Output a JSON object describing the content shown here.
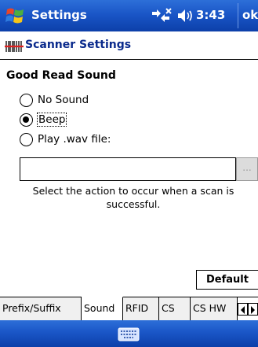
{
  "titlebar": {
    "title": "Settings",
    "time": "3:43",
    "ok_label": "ok"
  },
  "header": {
    "title": "Scanner Settings"
  },
  "section": {
    "title": "Good Read Sound"
  },
  "options": [
    {
      "label": "No Sound",
      "selected": false
    },
    {
      "label": "Beep",
      "selected": true
    },
    {
      "label": "Play .wav file:",
      "selected": false
    }
  ],
  "file": {
    "value": "",
    "browse_label": "..."
  },
  "help_text": "Select the action to occur when a scan is successful.",
  "default_label": "Default",
  "tabs": [
    {
      "label": "Prefix/Suffix",
      "active": false
    },
    {
      "label": "Sound",
      "active": true
    },
    {
      "label": "RFID",
      "active": false
    },
    {
      "label": "CS",
      "active": false
    },
    {
      "label": "CS HW",
      "active": false
    }
  ],
  "colors": {
    "titlebar": "#1a56c7",
    "header_text": "#0a2a8c"
  }
}
